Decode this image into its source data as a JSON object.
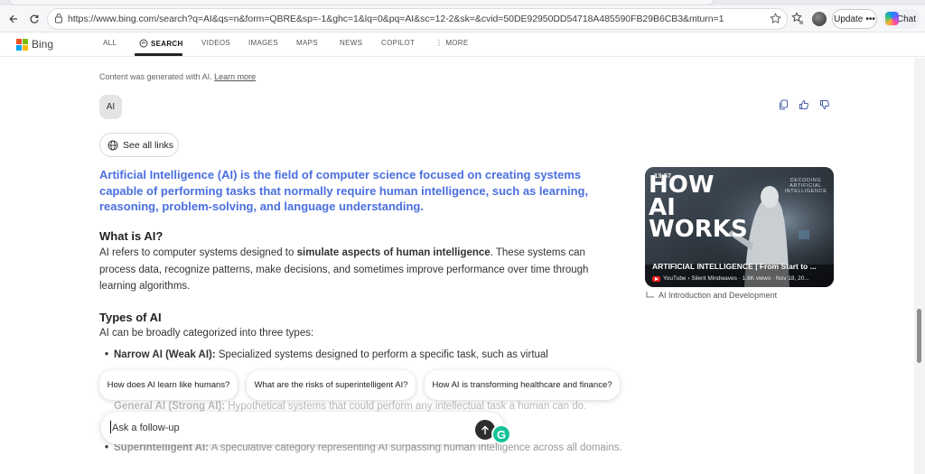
{
  "browser": {
    "url": "https://www.bing.com/search?q=AI&qs=n&form=QBRE&sp=-1&ghc=1&lq=0&pq=AI&sc=12-2&sk=&cvid=50DE92950DD54718A485590FB29B6CB3&mturn=1",
    "update_label": "Update",
    "chat_label": "Chat"
  },
  "bing": {
    "logo_text": "Bing",
    "nav": [
      "ALL",
      "SEARCH",
      "VIDEOS",
      "IMAGES",
      "MAPS",
      "NEWS",
      "COPILOT",
      "MORE"
    ],
    "active_nav": "SEARCH"
  },
  "answer": {
    "disclaimer": "Content was generated with AI.",
    "learn_more": "Learn more",
    "query_pill": "AI",
    "see_all_links": "See all links",
    "lead": "Artificial Intelligence (AI) is the field of computer science focused on creating systems capable of performing tasks that normally require human intelligence, such as learning, reasoning, problem-solving, and language understanding.",
    "what_is_heading": "What is AI?",
    "what_is_pre": "AI refers to computer systems designed to ",
    "what_is_bold": "simulate aspects of human intelligence",
    "what_is_post": ". These systems can process data, recognize patterns, make decisions, and sometimes improve performance over time through learning algorithms.",
    "types_heading": "Types of AI",
    "types_intro": "AI can be broadly categorized into three types:",
    "types": [
      {
        "name": "Narrow AI (Weak AI):",
        "desc": "Specialized systems designed to perform a specific task, such as virtual"
      },
      {
        "name": "General AI (Strong AI):",
        "desc": "Hypothetical systems that could perform any intellectual task a human can do."
      },
      {
        "name": "Superintelligent AI:",
        "desc": "A speculative category representing AI surpassing human intelligence across all domains."
      }
    ]
  },
  "video": {
    "duration": "13:57",
    "title": "ARTIFICIAL INTELLIGENCE | From Start to ...",
    "meta": "YouTube › Silent Mindwaves · 1.6K views · Nov 18, 20...",
    "thumb_big": "HOW AI WORKS",
    "thumb_small": "DECODING ARTIFICIAL INTELLIGENCE",
    "caption": "AI Introduction and Development"
  },
  "suggestions": [
    "How does AI learn like humans?",
    "What are the risks of superintelligent AI?",
    "How AI is transforming healthcare and finance?"
  ],
  "followup": {
    "placeholder": "Ask a follow-up"
  },
  "colors": {
    "accent_blue": "#4a6fe0",
    "ms_red": "#f25022",
    "ms_green": "#7fba00",
    "ms_blue": "#00a4ef",
    "ms_yellow": "#ffb900",
    "grammarly": "#15c39a"
  }
}
